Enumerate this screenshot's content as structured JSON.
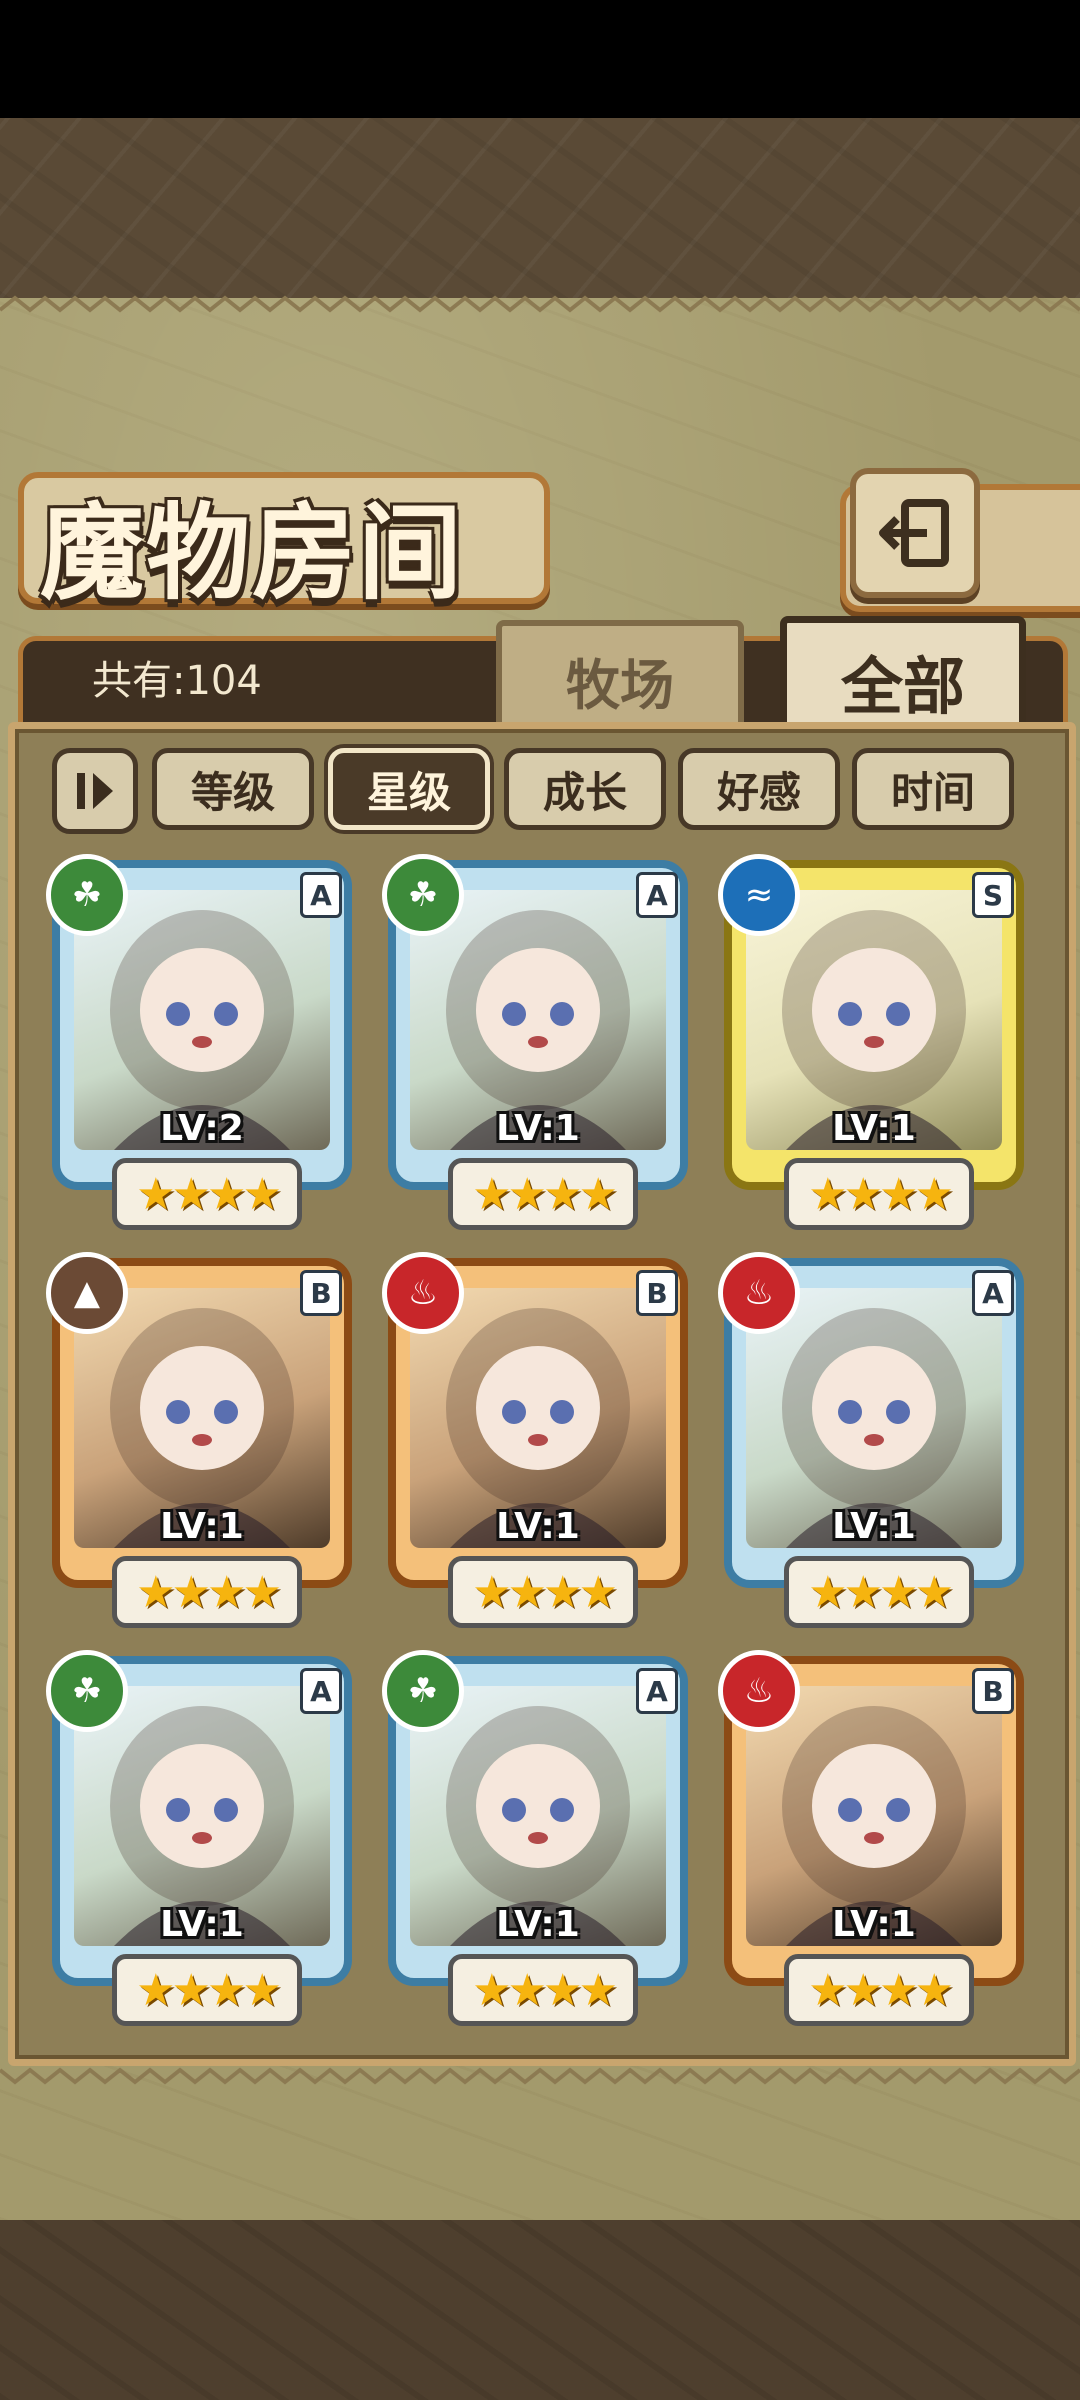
{
  "header": {
    "title": "魔物房间",
    "total_label": "共有:104"
  },
  "tabs": [
    {
      "label": "牧场",
      "active": false
    },
    {
      "label": "全部",
      "active": true
    }
  ],
  "filters": [
    {
      "label": "等级",
      "active": false
    },
    {
      "label": "星级",
      "active": true
    },
    {
      "label": "成长",
      "active": false
    },
    {
      "label": "好感",
      "active": false
    },
    {
      "label": "时间",
      "active": false
    }
  ],
  "monsters": [
    {
      "level": "LV:2",
      "rank": "A",
      "element": "wood",
      "frame": "blue",
      "stars": 4
    },
    {
      "level": "LV:1",
      "rank": "A",
      "element": "wood",
      "frame": "blue",
      "stars": 4
    },
    {
      "level": "LV:1",
      "rank": "S",
      "element": "water",
      "frame": "gold",
      "stars": 4
    },
    {
      "level": "LV:1",
      "rank": "B",
      "element": "earth",
      "frame": "orange",
      "stars": 4
    },
    {
      "level": "LV:1",
      "rank": "B",
      "element": "fire",
      "frame": "orange",
      "stars": 4
    },
    {
      "level": "LV:1",
      "rank": "A",
      "element": "fire",
      "frame": "blue",
      "stars": 4
    },
    {
      "level": "LV:1",
      "rank": "A",
      "element": "wood",
      "frame": "blue",
      "stars": 4
    },
    {
      "level": "LV:1",
      "rank": "A",
      "element": "wood",
      "frame": "blue",
      "stars": 4
    },
    {
      "level": "LV:1",
      "rank": "B",
      "element": "fire",
      "frame": "orange",
      "stars": 4
    }
  ],
  "colors": {
    "wood": "#3d8a3a",
    "fire": "#c8262a",
    "water": "#1d6fb8",
    "earth": "#6b4a35",
    "panel": "#a39a6c",
    "frame_border": "#b27837"
  }
}
